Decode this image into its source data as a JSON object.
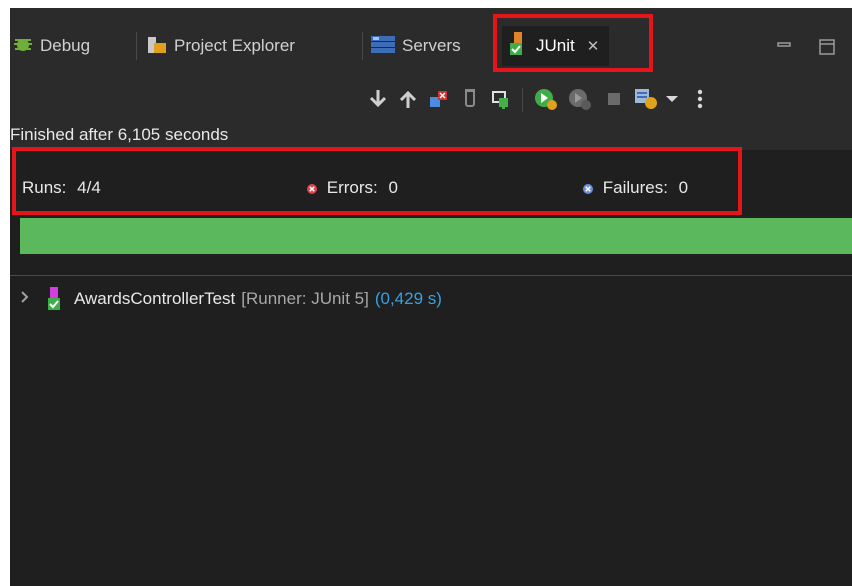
{
  "tabs": [
    {
      "id": "debug",
      "label": "Debug",
      "icon": "bug-icon"
    },
    {
      "id": "project",
      "label": "Project Explorer",
      "icon": "project-explorer-icon"
    },
    {
      "id": "servers",
      "label": "Servers",
      "icon": "servers-icon"
    },
    {
      "id": "junit",
      "label": "JUnit",
      "icon": "junit-icon",
      "close": "✕",
      "active": true
    }
  ],
  "status": {
    "finished": "Finished after 6,105 seconds"
  },
  "counters": {
    "runs_label": "Runs:",
    "runs_value": "4/4",
    "errors_label": "Errors:",
    "errors_value": "0",
    "failures_label": "Failures:",
    "failures_value": "0"
  },
  "progress": {
    "fraction": 1.0,
    "color": "#5cb85c"
  },
  "tree": [
    {
      "name": "AwardsControllerTest",
      "runner": "[Runner: JUnit 5]",
      "time": "(0,429 s)"
    }
  ],
  "colors": {
    "highlight": "#e4161c",
    "error": "#e0424c",
    "failure": "#6a8fd8",
    "time": "#39a0e0"
  }
}
